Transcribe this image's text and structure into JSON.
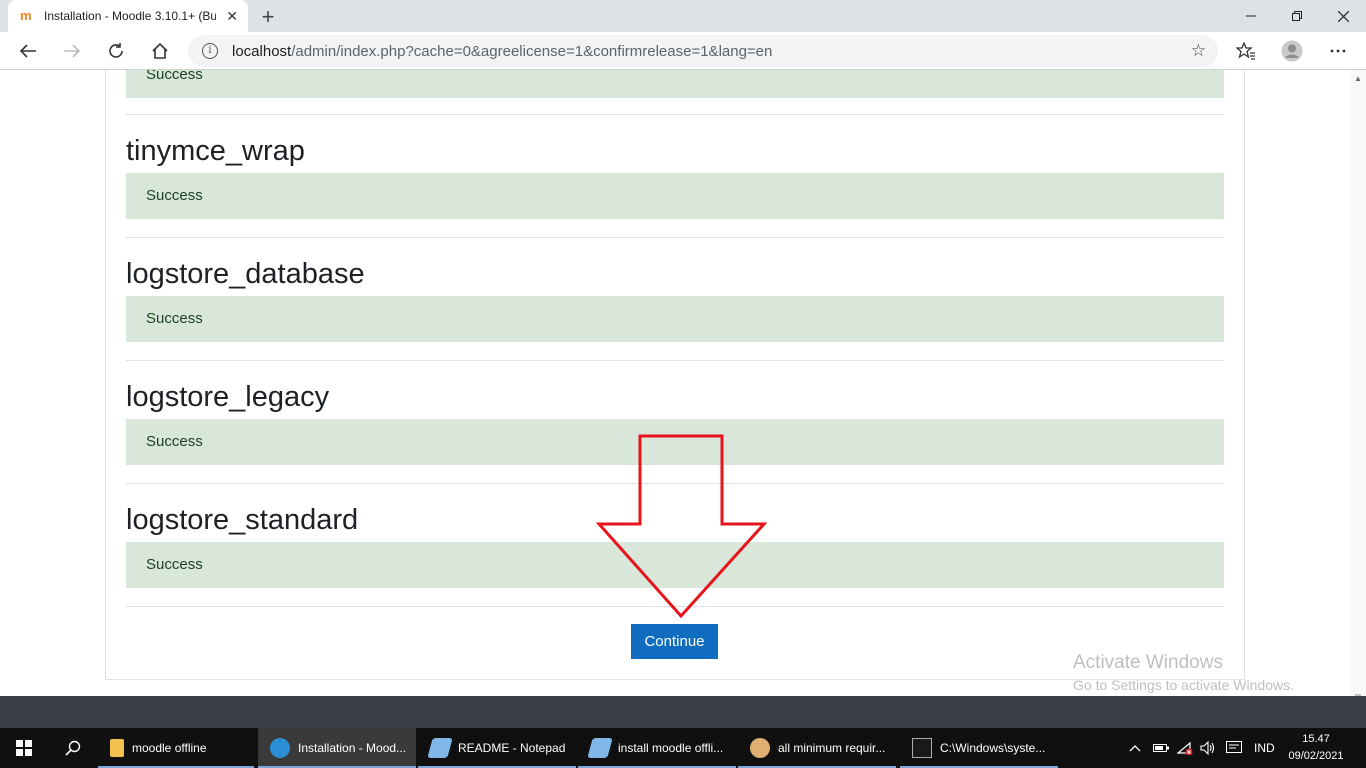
{
  "browser": {
    "tab_title": "Installation - Moodle 3.10.1+ (Build",
    "tab_close": "✕",
    "new_tab": "+",
    "url_host": "localhost",
    "url_path": "/admin/index.php?cache=0&agreelicense=1&confirmrelease=1&lang=en",
    "window_controls": [
      "minimize",
      "restore",
      "close"
    ]
  },
  "page": {
    "top_partial_status": "Success",
    "sections": [
      {
        "title": "tinymce_wrap",
        "status": "Success"
      },
      {
        "title": "logstore_database",
        "status": "Success"
      },
      {
        "title": "logstore_legacy",
        "status": "Success"
      },
      {
        "title": "logstore_standard",
        "status": "Success"
      }
    ],
    "continue_label": "Continue",
    "annotation_arrow_color": "#e8141d",
    "activate_title": "Activate Windows",
    "activate_subtitle": "Go to Settings to activate Windows."
  },
  "taskbar": {
    "items": [
      {
        "label": "moodle offline",
        "icon": "folder-icon",
        "color": "#f2c14e"
      },
      {
        "label": "Installation - Mood...",
        "icon": "edge-icon",
        "color": "#2b8fd6",
        "active": true
      },
      {
        "label": "README - Notepad",
        "icon": "notepad-icon",
        "color": "#7fb8e8"
      },
      {
        "label": "install moodle offli...",
        "icon": "notepad-icon",
        "color": "#7fb8e8"
      },
      {
        "label": "all minimum requir...",
        "icon": "paint-icon",
        "color": "#e0b070"
      },
      {
        "label": "C:\\Windows\\syste...",
        "icon": "cmd-icon",
        "color": "#1a1a1a"
      }
    ],
    "lang": "IND",
    "time": "15.47",
    "date": "09/02/2021"
  },
  "colors": {
    "success_bg": "#d9e6da",
    "success_text": "#1c4321",
    "button": "#0f6cbf"
  }
}
